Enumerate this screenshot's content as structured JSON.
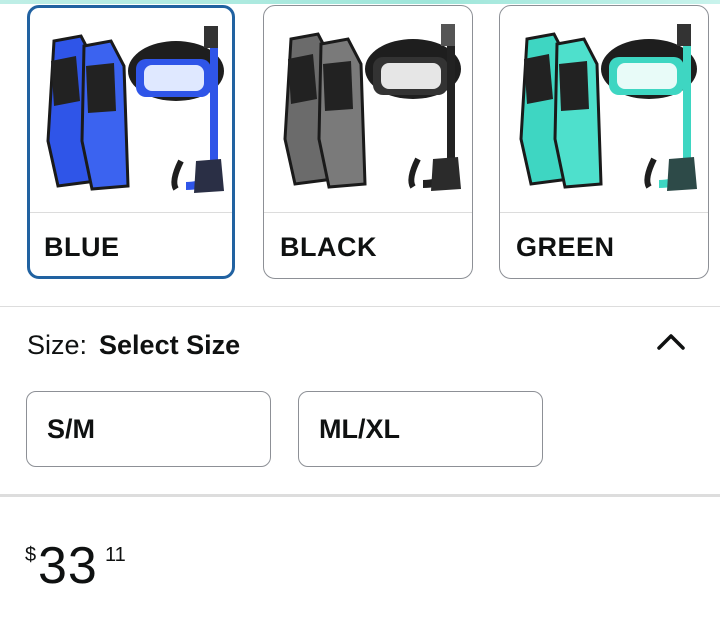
{
  "colors": {
    "selected_border": "#2162a1",
    "blue_product": "#2f55e8",
    "black_product": "#4a4a4a",
    "green_product": "#3ed6c2"
  },
  "swatches": [
    {
      "label": "BLUE",
      "selected": true,
      "icon": "blue-snorkel-set-image"
    },
    {
      "label": "BLACK",
      "selected": false,
      "icon": "black-snorkel-set-image"
    },
    {
      "label": "GREEN",
      "selected": false,
      "icon": "green-snorkel-set-image"
    }
  ],
  "size": {
    "label": "Size:",
    "value": "Select Size",
    "toggle_icon": "chevron-up-icon",
    "options": [
      "S/M",
      "ML/XL"
    ]
  },
  "price": {
    "symbol": "$",
    "whole": "33",
    "fraction": "11"
  }
}
